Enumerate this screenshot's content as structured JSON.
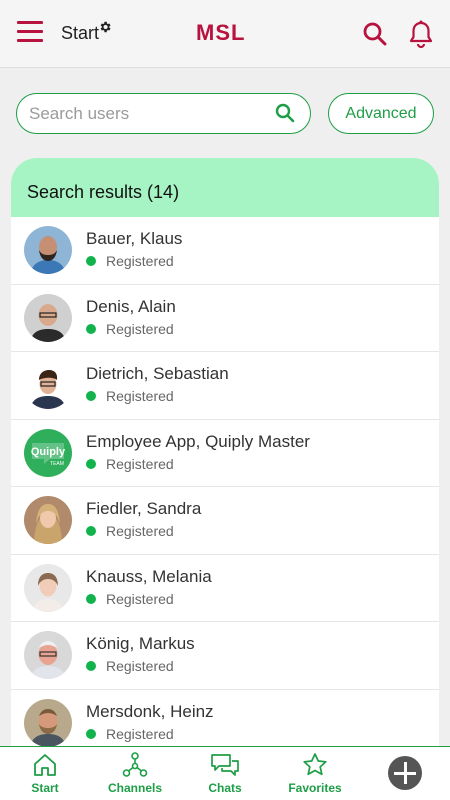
{
  "header": {
    "title": "Start",
    "logo_text": "MSL",
    "icons": [
      "menu-icon",
      "gear-icon",
      "search-icon",
      "bell-icon"
    ]
  },
  "search": {
    "placeholder": "Search users",
    "value": "",
    "advanced_label": "Advanced"
  },
  "results": {
    "header": "Search results (14)",
    "users": [
      {
        "name": "Bauer, Klaus",
        "status": "Registered"
      },
      {
        "name": "Denis, Alain",
        "status": "Registered"
      },
      {
        "name": "Dietrich, Sebastian",
        "status": "Registered"
      },
      {
        "name": "Employee App, Quiply Master",
        "status": "Registered"
      },
      {
        "name": "Fiedler, Sandra",
        "status": "Registered"
      },
      {
        "name": "Knauss, Melania",
        "status": "Registered"
      },
      {
        "name": "König, Markus",
        "status": "Registered"
      },
      {
        "name": "Mersdonk, Heinz",
        "status": "Registered"
      }
    ]
  },
  "nav": {
    "items": [
      {
        "label": "Start",
        "icon": "home-icon"
      },
      {
        "label": "Channels",
        "icon": "channels-icon"
      },
      {
        "label": "Chats",
        "icon": "chats-icon"
      },
      {
        "label": "Favorites",
        "icon": "star-icon"
      }
    ],
    "add_icon": "add-icon"
  },
  "colors": {
    "brand": "#b8123e",
    "accent_green": "#1e9e46",
    "results_header_bg": "#a6f3c4",
    "status_green": "#12b34d"
  }
}
